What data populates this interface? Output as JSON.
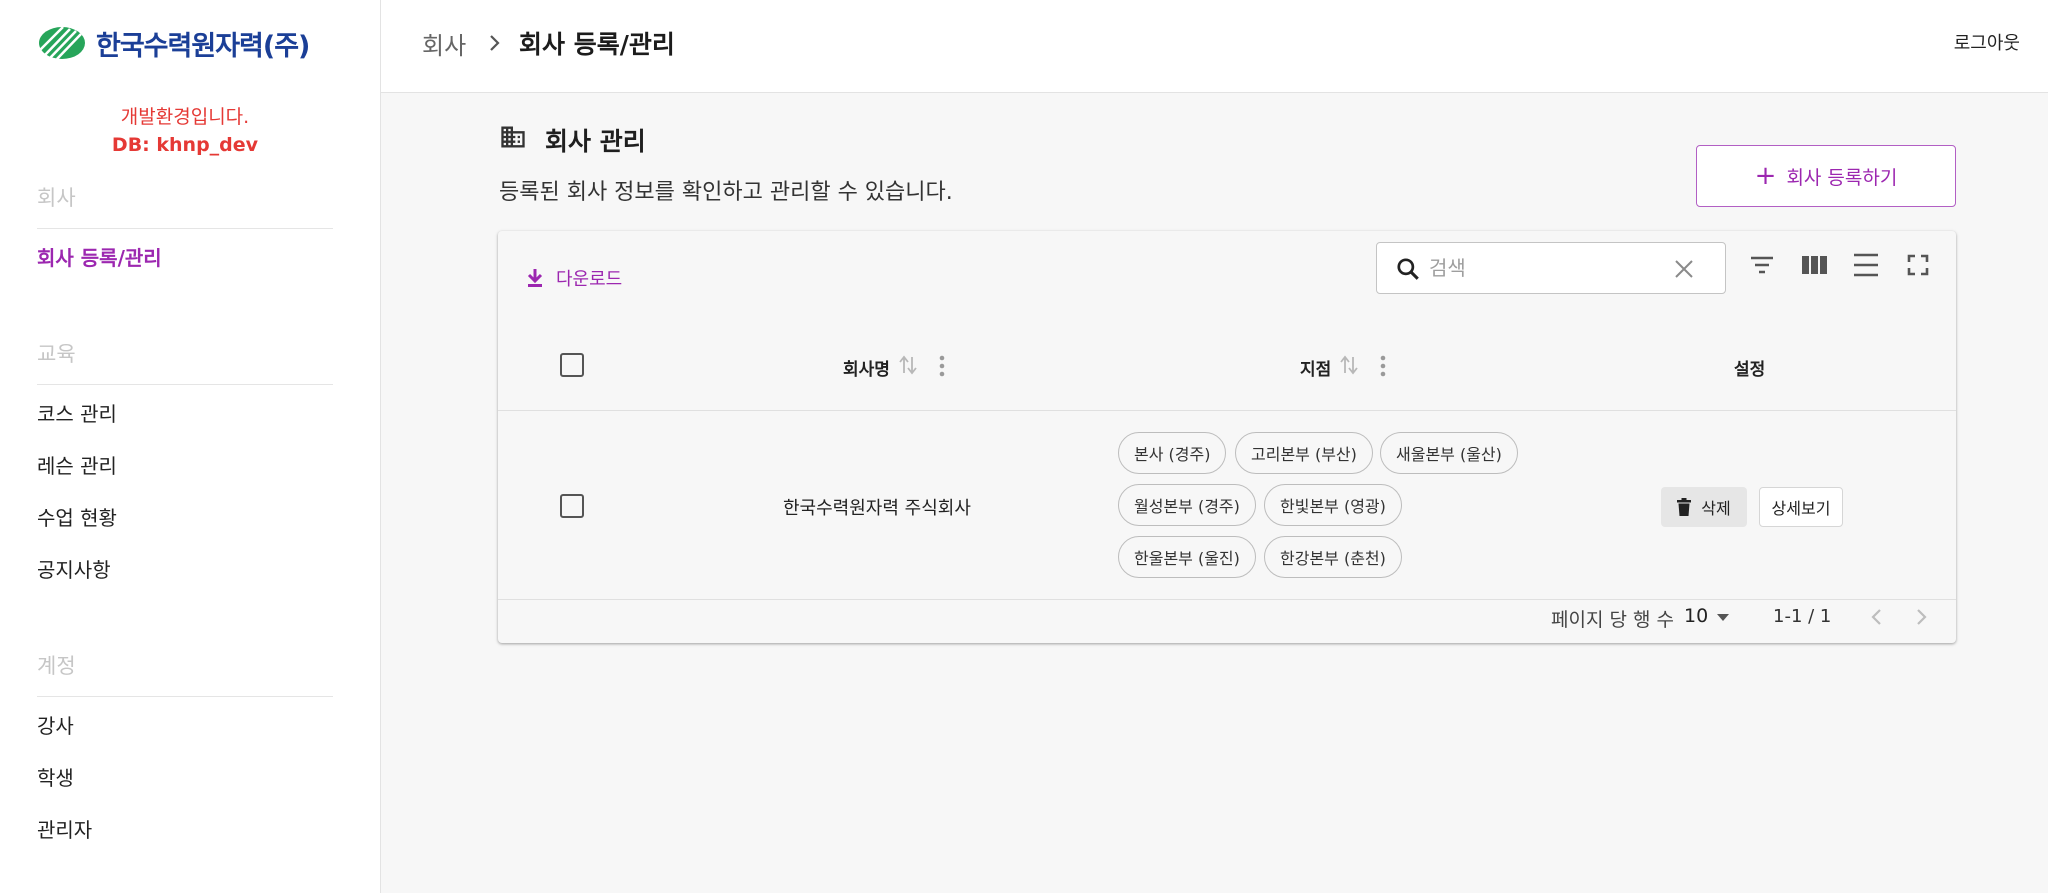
{
  "brand": {
    "logo_text": "한국수력원자력(주)",
    "accent": "#9c27b0",
    "logo_color": "#1b3f97"
  },
  "dev_notice": {
    "line1": "개발환경입니다.",
    "line2": "DB: khnp_dev"
  },
  "sidebar": {
    "sections": [
      {
        "title": "회사",
        "items": [
          {
            "label": "회사 등록/관리",
            "active": true
          }
        ]
      },
      {
        "title": "교육",
        "items": [
          {
            "label": "코스 관리"
          },
          {
            "label": "레슨 관리"
          },
          {
            "label": "수업 현황"
          },
          {
            "label": "공지사항"
          }
        ]
      },
      {
        "title": "계정",
        "items": [
          {
            "label": "강사"
          },
          {
            "label": "학생"
          },
          {
            "label": "관리자"
          }
        ]
      }
    ]
  },
  "header": {
    "breadcrumb_parent": "회사",
    "breadcrumb_current": "회사 등록/관리",
    "logout_label": "로그아웃"
  },
  "page": {
    "icon": "building-icon",
    "title": "회사 관리",
    "description": "등록된 회사 정보를 확인하고 관리할 수 있습니다.",
    "add_button_label": "회사 등록하기"
  },
  "toolbar": {
    "download_label": "다운로드",
    "search_placeholder": "검색",
    "tools": [
      "filter-icon",
      "columns-icon",
      "density-icon",
      "fullscreen-icon"
    ]
  },
  "table": {
    "columns": {
      "name": "회사명",
      "branch": "지점",
      "settings": "설정"
    },
    "rows": [
      {
        "name": "한국수력원자력 주식회사",
        "branches": [
          "본사 (경주)",
          "고리본부 (부산)",
          "새울본부 (울산)",
          "월성본부 (경주)",
          "한빛본부 (영광)",
          "한울본부 (울진)",
          "한강본부 (춘천)"
        ],
        "delete_label": "삭제",
        "detail_label": "상세보기"
      }
    ]
  },
  "pagination": {
    "rows_per_page_label": "페이지 당 행 수",
    "rows_per_page": "10",
    "range": "1-1 / 1"
  }
}
